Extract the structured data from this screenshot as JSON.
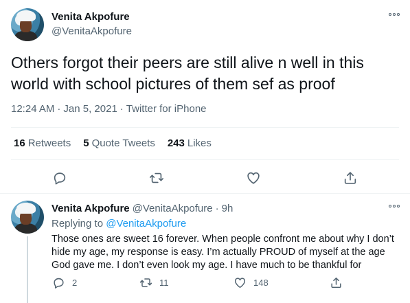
{
  "tweet": {
    "author_name": "Venita Akpofure",
    "author_handle": "@VenitaAkpofure",
    "text": "Others forgot their peers are still alive n well in this world with school pictures of them sef as proof",
    "time": "12:24 AM",
    "date": "Jan 5, 2021",
    "source": "Twitter for iPhone",
    "stats": {
      "retweets_count": "16",
      "retweets_label": "Retweets",
      "quotes_count": "5",
      "quotes_label": "Quote Tweets",
      "likes_count": "243",
      "likes_label": "Likes"
    },
    "actions": [
      "reply-icon",
      "retweet-icon",
      "like-icon",
      "share-icon"
    ]
  },
  "reply": {
    "author_name": "Venita Akpofure",
    "author_handle": "@VenitaAkpofure",
    "age": "9h",
    "replying_prefix": "Replying to",
    "replying_to": "@VenitaAkpofure",
    "text": "Those ones are sweet 16 forever. When people confront me about why I don’t hide my age, my response is easy. I’m actually PROUD of myself at the age God gave me. I don’t even look my age. I have much to be thankful for",
    "reply_count": "2",
    "retweet_count": "11",
    "like_count": "148"
  },
  "colors": {
    "text": "#0f1419",
    "secondary": "#536471",
    "link": "#1d9bf0",
    "divider": "#eff3f4"
  }
}
